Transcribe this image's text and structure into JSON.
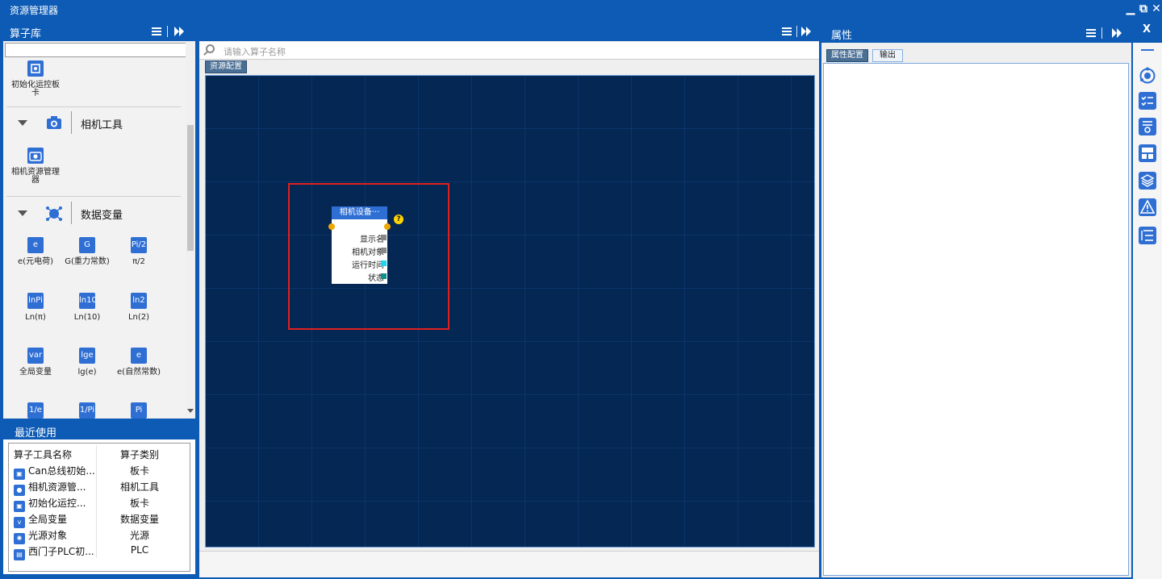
{
  "window": {
    "title": "资源管理器",
    "buttons": [
      "minimize",
      "restore",
      "close"
    ]
  },
  "left_panel": {
    "title": "算子库",
    "top_item": {
      "label": "初始化运控板卡",
      "icon": "motion-card-icon"
    },
    "categories": [
      {
        "name": "相机工具",
        "icon": "camera-icon",
        "items": [
          {
            "label": "相机资源管理器",
            "icon": "camera-gear-icon"
          }
        ]
      },
      {
        "name": "数据变量",
        "icon": "variable-icon",
        "items": [
          {
            "icon_text": "e",
            "label": "e(元电荷)"
          },
          {
            "icon_text": "G",
            "label": "G(重力常数)"
          },
          {
            "icon_text": "Pi/2",
            "label": "π/2"
          },
          {
            "icon_text": "lnPi",
            "label": "Ln(π)"
          },
          {
            "icon_text": "ln10",
            "label": "Ln(10)"
          },
          {
            "icon_text": "ln2",
            "label": "Ln(2)"
          },
          {
            "icon_text": "var",
            "label": "全局变量"
          },
          {
            "icon_text": "lge",
            "label": "lg(e)"
          },
          {
            "icon_text": "e",
            "label": "e(自然常数)"
          },
          {
            "icon_text": "1/e",
            "label": ""
          },
          {
            "icon_text": "1/Pi",
            "label": ""
          },
          {
            "icon_text": "Pi",
            "label": ""
          }
        ]
      }
    ]
  },
  "recent": {
    "title": "最近使用",
    "columns": [
      "算子工具名称",
      "算子类别"
    ],
    "rows": [
      {
        "name": "Can总线初始...",
        "category": "板卡",
        "icon": "can-bus-icon"
      },
      {
        "name": "相机资源管...",
        "category": "相机工具",
        "icon": "camera-icon"
      },
      {
        "name": "初始化运控...",
        "category": "板卡",
        "icon": "motion-card-icon"
      },
      {
        "name": "全局变量",
        "category": "数据变量",
        "icon": "var-icon"
      },
      {
        "name": "光源对象",
        "category": "光源",
        "icon": "light-source-icon"
      },
      {
        "name": "西门子PLC初...",
        "category": "PLC",
        "icon": "plc-icon"
      }
    ]
  },
  "center": {
    "search_placeholder": "请输入算子名称",
    "tab_label": "资源配置",
    "node": {
      "title": "相机设备···",
      "help_badge": "?",
      "ports": [
        {
          "label": "显示名",
          "color": "#888888"
        },
        {
          "label": "相机对象",
          "color": "#888888"
        },
        {
          "label": "运行时间",
          "color": "#22d3ee"
        },
        {
          "label": "状态",
          "color": "#0e8f8f"
        }
      ]
    }
  },
  "right_panel": {
    "title": "属性",
    "tabs": [
      {
        "label": "属性配置",
        "active": true
      },
      {
        "label": "输出",
        "active": false
      }
    ]
  },
  "right_toolbar": {
    "close_label": "X",
    "icons": [
      "orbit-icon",
      "checklist-icon",
      "list-settings-icon",
      "layout-icon",
      "layers-icon",
      "warning-icon",
      "tree-list-icon"
    ]
  },
  "colors": {
    "accent": "#0d5bb5",
    "canvas_bg": "#042753",
    "selection": "#e02020",
    "node_header": "#2f6fd4"
  }
}
